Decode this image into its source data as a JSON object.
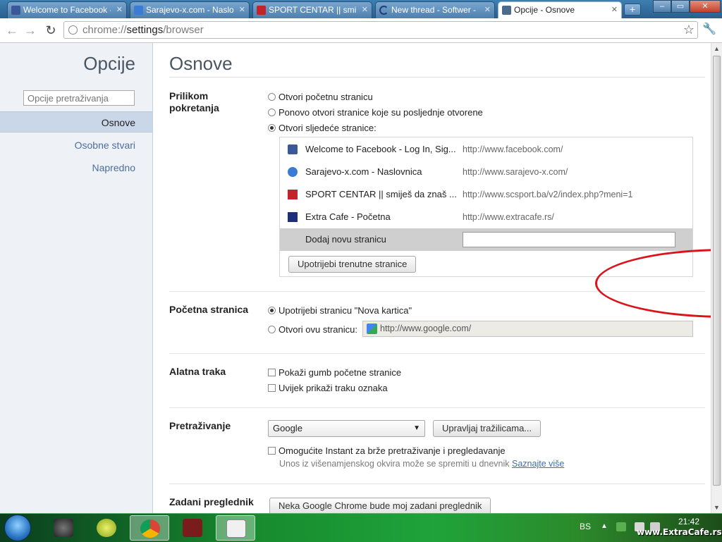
{
  "tabs": [
    {
      "label": "Welcome to Facebook -",
      "icon": "facebook-icon",
      "active": false
    },
    {
      "label": "Sarajevo-x.com - Naslov",
      "icon": "sarajevo-x-icon",
      "active": false
    },
    {
      "label": "SPORT CENTAR || smiješ",
      "icon": "sport-centar-icon",
      "active": false
    },
    {
      "label": "New thread - Softwer -",
      "icon": "loading-icon",
      "active": false
    },
    {
      "label": "Opcije - Osnove",
      "icon": "wrench-icon",
      "active": true
    }
  ],
  "toolbar": {
    "url_scheme": "chrome://",
    "url_host": "settings",
    "url_path": "/browser"
  },
  "sidebar": {
    "title": "Opcije",
    "search_placeholder": "Opcije pretraživanja",
    "items": [
      {
        "label": "Osnove",
        "active": true
      },
      {
        "label": "Osobne stvari",
        "active": false
      },
      {
        "label": "Napredno",
        "active": false
      }
    ]
  },
  "main": {
    "title": "Osnove",
    "startup": {
      "label": "Prilikom pokretanja",
      "options": [
        {
          "label": "Otvori početnu stranicu",
          "selected": false
        },
        {
          "label": "Ponovo otvori stranice koje su posljednje otvorene",
          "selected": false
        },
        {
          "label": "Otvori sljedeće stranice:",
          "selected": true
        }
      ],
      "pages": [
        {
          "title": "Welcome to Facebook - Log In, Sig...",
          "url": "http://www.facebook.com/",
          "icon": "facebook-icon"
        },
        {
          "title": "Sarajevo-x.com - Naslovnica",
          "url": "http://www.sarajevo-x.com/",
          "icon": "sarajevo-x-icon"
        },
        {
          "title": "SPORT CENTAR || smiješ da znaš ...",
          "url": "http://www.scsport.ba/v2/index.php?meni=1",
          "icon": "sport-centar-icon"
        },
        {
          "title": "Extra Cafe - Početna",
          "url": "http://www.extracafe.rs/",
          "icon": "extra-cafe-icon"
        }
      ],
      "add_label": "Dodaj novu stranicu",
      "add_value": "",
      "use_current_button": "Upotrijebi trenutne stranice"
    },
    "homepage": {
      "label": "Početna stranica",
      "option_new_tab": "Upotrijebi stranicu \"Nova kartica\"",
      "option_open": "Otvori ovu stranicu:",
      "url": "http://www.google.com/"
    },
    "toolbar_section": {
      "label": "Alatna traka",
      "options": [
        {
          "label": "Pokaži gumb početne stranice",
          "checked": false
        },
        {
          "label": "Uvijek prikaži traku oznaka",
          "checked": false
        }
      ]
    },
    "search": {
      "label": "Pretraživanje",
      "engine": "Google",
      "manage_button": "Upravljaj tražilicama...",
      "instant_label": "Omogućite Instant za brže pretraživanje i pregledavanje",
      "instant_hint": "Unos iz višenamjenskog okvira može se spremiti u dnevnik",
      "learn_more": "Saznajte više"
    },
    "default_browser": {
      "label": "Zadani preglednik",
      "button": "Neka Google Chrome bude moj zadani preglednik"
    }
  },
  "taskbar": {
    "apps": [
      "game-icon",
      "tennis-ball-icon",
      "chrome-icon",
      "utorrent-icon",
      "document-icon"
    ],
    "active_app": "chrome-icon",
    "language": "BS",
    "time": "21:42",
    "watermark": "www.ExtraCafe.rs"
  },
  "colors": {
    "annotation": "#d9141b",
    "link": "#3d6cb3",
    "sidebar_active": "#c9d7e9"
  }
}
